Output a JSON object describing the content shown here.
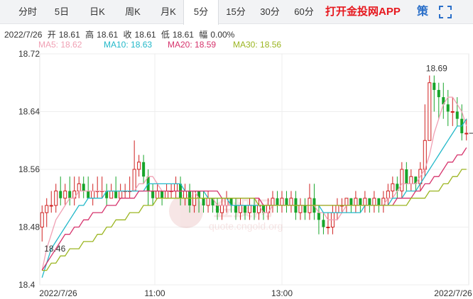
{
  "tabs": [
    {
      "label": "分时",
      "active": false
    },
    {
      "label": "5日",
      "active": false
    },
    {
      "label": "日K",
      "active": false
    },
    {
      "label": "周K",
      "active": false
    },
    {
      "label": "月K",
      "active": false
    },
    {
      "label": "5分",
      "active": true
    },
    {
      "label": "15分",
      "active": false
    },
    {
      "label": "30分",
      "active": false
    },
    {
      "label": "60分",
      "active": false
    }
  ],
  "app_link": "打开金投网APP",
  "strategy_label": "策",
  "toolbar_icons": [
    "strategy-icon",
    "fullscreen-icon"
  ],
  "quote": {
    "date": "2022/7/26",
    "open_label": "开",
    "open": "18.61",
    "high_label": "高",
    "high": "18.61",
    "close_label": "收",
    "close": "18.61",
    "low_label": "低",
    "low": "18.61",
    "change_label": "幅",
    "change": "0.00%"
  },
  "ma": [
    {
      "label": "MA5: 18.62",
      "color": "#f0a0b4"
    },
    {
      "label": "MA10: 18.63",
      "color": "#22b8c9"
    },
    {
      "label": "MA20: 18.59",
      "color": "#d6336c"
    },
    {
      "label": "MA30: 18.56",
      "color": "#9bb520"
    }
  ],
  "colors": {
    "up": "#d02020",
    "down": "#17a52a"
  },
  "watermark": {
    "cn": "金投网",
    "en": "quote.cngold.org"
  },
  "chart_data": {
    "type": "candlestick",
    "ylim": [
      18.4,
      18.72
    ],
    "yticks": [
      "18.72",
      "18.64",
      "18.56",
      "18.48",
      "18.4"
    ],
    "xticks": [
      "2022/7/26",
      "11:00",
      "13:00",
      "2022/7/26"
    ],
    "max_label": "18.69",
    "min_label": "18.46",
    "candles": [
      [
        18.48,
        18.5,
        18.51,
        18.46
      ],
      [
        18.5,
        18.51,
        18.52,
        18.48
      ],
      [
        18.51,
        18.51,
        18.53,
        18.5
      ],
      [
        18.51,
        18.53,
        18.54,
        18.5
      ],
      [
        18.53,
        18.52,
        18.55,
        18.51
      ],
      [
        18.52,
        18.53,
        18.54,
        18.51
      ],
      [
        18.53,
        18.52,
        18.55,
        18.51
      ],
      [
        18.52,
        18.53,
        18.55,
        18.51
      ],
      [
        18.53,
        18.54,
        18.55,
        18.52
      ],
      [
        18.54,
        18.53,
        18.55,
        18.52
      ],
      [
        18.53,
        18.52,
        18.55,
        18.52
      ],
      [
        18.52,
        18.53,
        18.54,
        18.51
      ],
      [
        18.53,
        18.53,
        18.55,
        18.52
      ],
      [
        18.53,
        18.53,
        18.55,
        18.52
      ],
      [
        18.53,
        18.52,
        18.54,
        18.51
      ],
      [
        18.52,
        18.53,
        18.54,
        18.52
      ],
      [
        18.53,
        18.52,
        18.55,
        18.52
      ],
      [
        18.52,
        18.53,
        18.54,
        18.52
      ],
      [
        18.53,
        18.53,
        18.54,
        18.52
      ],
      [
        18.53,
        18.53,
        18.55,
        18.52
      ],
      [
        18.53,
        18.56,
        18.6,
        18.53
      ],
      [
        18.56,
        18.57,
        18.58,
        18.55
      ],
      [
        18.57,
        18.55,
        18.58,
        18.54
      ],
      [
        18.55,
        18.53,
        18.56,
        18.51
      ],
      [
        18.53,
        18.52,
        18.54,
        18.51
      ],
      [
        18.52,
        18.53,
        18.54,
        18.52
      ],
      [
        18.53,
        18.52,
        18.53,
        18.51
      ],
      [
        18.52,
        18.53,
        18.54,
        18.52
      ],
      [
        18.53,
        18.53,
        18.54,
        18.52
      ],
      [
        18.53,
        18.54,
        18.55,
        18.52
      ],
      [
        18.54,
        18.52,
        18.55,
        18.51
      ],
      [
        18.52,
        18.53,
        18.54,
        18.51
      ],
      [
        18.53,
        18.51,
        18.54,
        18.5
      ],
      [
        18.51,
        18.53,
        18.53,
        18.5
      ],
      [
        18.53,
        18.52,
        18.53,
        18.5
      ],
      [
        18.52,
        18.51,
        18.53,
        18.5
      ],
      [
        18.51,
        18.52,
        18.53,
        18.5
      ],
      [
        18.52,
        18.51,
        18.52,
        18.5
      ],
      [
        18.51,
        18.5,
        18.52,
        18.49
      ],
      [
        18.5,
        18.51,
        18.52,
        18.49
      ],
      [
        18.51,
        18.52,
        18.53,
        18.5
      ],
      [
        18.52,
        18.51,
        18.52,
        18.5
      ],
      [
        18.51,
        18.5,
        18.52,
        18.49
      ],
      [
        18.5,
        18.51,
        18.52,
        18.49
      ],
      [
        18.51,
        18.5,
        18.51,
        18.49
      ],
      [
        18.5,
        18.51,
        18.52,
        18.49
      ],
      [
        18.51,
        18.5,
        18.52,
        18.49
      ],
      [
        18.5,
        18.51,
        18.52,
        18.49
      ],
      [
        18.51,
        18.5,
        18.51,
        18.49
      ],
      [
        18.5,
        18.51,
        18.52,
        18.49
      ],
      [
        18.51,
        18.52,
        18.53,
        18.5
      ],
      [
        18.52,
        18.51,
        18.53,
        18.5
      ],
      [
        18.51,
        18.52,
        18.53,
        18.5
      ],
      [
        18.52,
        18.51,
        18.53,
        18.5
      ],
      [
        18.51,
        18.52,
        18.53,
        18.5
      ],
      [
        18.52,
        18.5,
        18.53,
        18.49
      ],
      [
        18.5,
        18.51,
        18.52,
        18.49
      ],
      [
        18.51,
        18.5,
        18.52,
        18.49
      ],
      [
        18.5,
        18.52,
        18.54,
        18.49
      ],
      [
        18.52,
        18.5,
        18.54,
        18.49
      ],
      [
        18.5,
        18.49,
        18.51,
        18.47
      ],
      [
        18.49,
        18.48,
        18.5,
        18.47
      ],
      [
        18.48,
        18.48,
        18.5,
        18.47
      ],
      [
        18.48,
        18.5,
        18.51,
        18.47
      ],
      [
        18.5,
        18.51,
        18.52,
        18.49
      ],
      [
        18.51,
        18.51,
        18.52,
        18.5
      ],
      [
        18.51,
        18.52,
        18.52,
        18.5
      ],
      [
        18.52,
        18.51,
        18.52,
        18.5
      ],
      [
        18.51,
        18.52,
        18.53,
        18.5
      ],
      [
        18.52,
        18.51,
        18.52,
        18.5
      ],
      [
        18.51,
        18.52,
        18.53,
        18.5
      ],
      [
        18.52,
        18.51,
        18.52,
        18.5
      ],
      [
        18.51,
        18.52,
        18.53,
        18.5
      ],
      [
        18.52,
        18.51,
        18.52,
        18.5
      ],
      [
        18.51,
        18.52,
        18.53,
        18.5
      ],
      [
        18.52,
        18.53,
        18.54,
        18.51
      ],
      [
        18.53,
        18.54,
        18.55,
        18.52
      ],
      [
        18.54,
        18.53,
        18.55,
        18.52
      ],
      [
        18.53,
        18.56,
        18.57,
        18.52
      ],
      [
        18.56,
        18.54,
        18.57,
        18.53
      ],
      [
        18.54,
        18.55,
        18.56,
        18.53
      ],
      [
        18.55,
        18.54,
        18.55,
        18.53
      ],
      [
        18.54,
        18.56,
        18.57,
        18.53
      ],
      [
        18.56,
        18.6,
        18.65,
        18.55
      ],
      [
        18.6,
        18.68,
        18.69,
        18.6
      ],
      [
        18.68,
        18.67,
        18.69,
        18.64
      ],
      [
        18.67,
        18.66,
        18.68,
        18.63
      ],
      [
        18.66,
        18.65,
        18.68,
        18.63
      ],
      [
        18.65,
        18.64,
        18.67,
        18.62
      ],
      [
        18.64,
        18.64,
        18.66,
        18.62
      ],
      [
        18.64,
        18.63,
        18.66,
        18.62
      ],
      [
        18.63,
        18.61,
        18.65,
        18.6
      ],
      [
        18.61,
        18.61,
        18.63,
        18.6
      ]
    ],
    "series": [
      {
        "name": "MA5",
        "values": [
          18.42,
          18.45,
          18.47,
          18.49,
          18.5,
          18.51,
          18.52,
          18.52,
          18.53,
          18.53,
          18.53,
          18.53,
          18.53,
          18.53,
          18.53,
          18.53,
          18.53,
          18.53,
          18.53,
          18.53,
          18.53,
          18.54,
          18.54,
          18.55,
          18.55,
          18.54,
          18.53,
          18.53,
          18.53,
          18.53,
          18.53,
          18.53,
          18.53,
          18.53,
          18.52,
          18.52,
          18.52,
          18.52,
          18.51,
          18.51,
          18.51,
          18.51,
          18.51,
          18.51,
          18.51,
          18.51,
          18.51,
          18.51,
          18.5,
          18.5,
          18.51,
          18.51,
          18.51,
          18.51,
          18.51,
          18.51,
          18.51,
          18.51,
          18.51,
          18.51,
          18.5,
          18.5,
          18.49,
          18.49,
          18.49,
          18.5,
          18.51,
          18.51,
          18.51,
          18.51,
          18.51,
          18.51,
          18.51,
          18.51,
          18.51,
          18.52,
          18.52,
          18.53,
          18.54,
          18.54,
          18.54,
          18.54,
          18.55,
          18.56,
          18.58,
          18.61,
          18.63,
          18.65,
          18.66,
          18.66,
          18.65,
          18.64,
          18.62
        ]
      },
      {
        "name": "MA10",
        "values": [
          18.41,
          18.43,
          18.45,
          18.46,
          18.47,
          18.48,
          18.49,
          18.5,
          18.51,
          18.51,
          18.52,
          18.52,
          18.52,
          18.52,
          18.53,
          18.53,
          18.53,
          18.53,
          18.53,
          18.53,
          18.53,
          18.53,
          18.53,
          18.54,
          18.54,
          18.54,
          18.54,
          18.54,
          18.54,
          18.54,
          18.54,
          18.53,
          18.53,
          18.53,
          18.53,
          18.53,
          18.52,
          18.52,
          18.52,
          18.52,
          18.52,
          18.51,
          18.51,
          18.51,
          18.51,
          18.51,
          18.51,
          18.51,
          18.51,
          18.51,
          18.51,
          18.51,
          18.51,
          18.51,
          18.51,
          18.51,
          18.51,
          18.51,
          18.51,
          18.51,
          18.51,
          18.5,
          18.5,
          18.5,
          18.5,
          18.5,
          18.5,
          18.5,
          18.5,
          18.5,
          18.51,
          18.51,
          18.51,
          18.51,
          18.51,
          18.51,
          18.52,
          18.52,
          18.52,
          18.53,
          18.53,
          18.53,
          18.54,
          18.55,
          18.56,
          18.57,
          18.58,
          18.59,
          18.6,
          18.61,
          18.62,
          18.62,
          18.63
        ]
      },
      {
        "name": "MA20",
        "values": [
          18.42,
          18.43,
          18.44,
          18.45,
          18.46,
          18.47,
          18.47,
          18.48,
          18.48,
          18.49,
          18.49,
          18.5,
          18.5,
          18.5,
          18.51,
          18.51,
          18.51,
          18.52,
          18.52,
          18.52,
          18.52,
          18.53,
          18.53,
          18.53,
          18.53,
          18.53,
          18.53,
          18.53,
          18.53,
          18.53,
          18.53,
          18.53,
          18.53,
          18.53,
          18.53,
          18.53,
          18.53,
          18.53,
          18.53,
          18.52,
          18.52,
          18.52,
          18.52,
          18.52,
          18.52,
          18.52,
          18.52,
          18.52,
          18.51,
          18.51,
          18.51,
          18.51,
          18.51,
          18.51,
          18.51,
          18.51,
          18.51,
          18.51,
          18.51,
          18.51,
          18.51,
          18.51,
          18.51,
          18.51,
          18.51,
          18.51,
          18.51,
          18.51,
          18.51,
          18.51,
          18.51,
          18.51,
          18.51,
          18.51,
          18.51,
          18.51,
          18.51,
          18.52,
          18.52,
          18.52,
          18.52,
          18.53,
          18.53,
          18.54,
          18.54,
          18.55,
          18.55,
          18.56,
          18.57,
          18.57,
          18.58,
          18.58,
          18.59
        ]
      },
      {
        "name": "MA30",
        "values": [
          18.42,
          18.42,
          18.43,
          18.43,
          18.44,
          18.44,
          18.45,
          18.45,
          18.45,
          18.46,
          18.46,
          18.46,
          18.47,
          18.47,
          18.48,
          18.48,
          18.49,
          18.49,
          18.49,
          18.5,
          18.5,
          18.5,
          18.51,
          18.51,
          18.51,
          18.52,
          18.52,
          18.52,
          18.52,
          18.52,
          18.52,
          18.52,
          18.52,
          18.52,
          18.52,
          18.52,
          18.52,
          18.52,
          18.52,
          18.52,
          18.52,
          18.52,
          18.52,
          18.52,
          18.52,
          18.52,
          18.52,
          18.51,
          18.51,
          18.51,
          18.51,
          18.51,
          18.51,
          18.51,
          18.51,
          18.51,
          18.51,
          18.51,
          18.51,
          18.51,
          18.51,
          18.51,
          18.51,
          18.51,
          18.51,
          18.51,
          18.51,
          18.51,
          18.51,
          18.51,
          18.51,
          18.51,
          18.51,
          18.51,
          18.51,
          18.51,
          18.51,
          18.51,
          18.51,
          18.51,
          18.52,
          18.52,
          18.52,
          18.52,
          18.53,
          18.53,
          18.53,
          18.54,
          18.54,
          18.55,
          18.55,
          18.56,
          18.56
        ]
      }
    ]
  }
}
